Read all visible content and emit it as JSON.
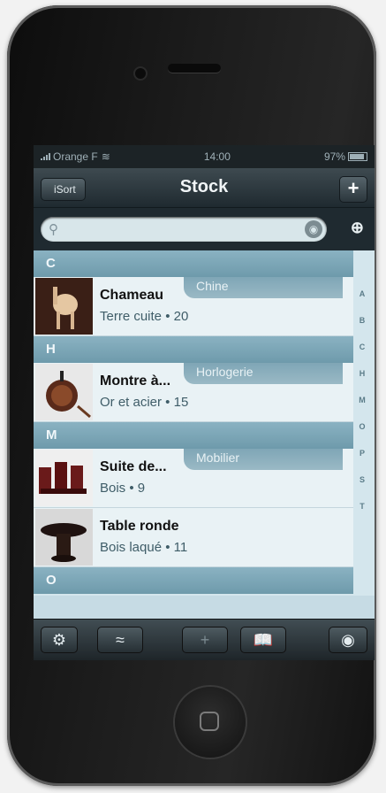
{
  "status": {
    "carrier": "Orange F",
    "time": "14:00",
    "battery": "97%"
  },
  "navbar": {
    "left_button": "iSort",
    "title": "Stock",
    "right_button": "+"
  },
  "search": {
    "placeholder": ""
  },
  "sections": [
    {
      "letter": "C",
      "items": [
        {
          "name": "Chameau",
          "detail": "Terre cuite • 20",
          "category": "Chine"
        }
      ]
    },
    {
      "letter": "H",
      "items": [
        {
          "name": "Montre à...",
          "detail": "Or et acier • 15",
          "category": "Horlogerie"
        }
      ]
    },
    {
      "letter": "M",
      "items": [
        {
          "name": "Suite de...",
          "detail": "Bois • 9",
          "category": "Mobilier"
        },
        {
          "name": "Table ronde",
          "detail": "Bois laqué • 11",
          "category": ""
        }
      ]
    },
    {
      "letter": "O",
      "items": []
    }
  ],
  "index_letters": [
    "",
    "A",
    "B",
    "C",
    "H",
    "M",
    "O",
    "P",
    "S",
    "T"
  ],
  "toolbar": {
    "icons": [
      "gear-icon",
      "wifi-icon",
      "add-icon",
      "book-icon",
      "eye-icon"
    ]
  },
  "colors": {
    "nav": "#2b363c",
    "section": "#7ea6b6",
    "row": "#e9f2f5"
  }
}
